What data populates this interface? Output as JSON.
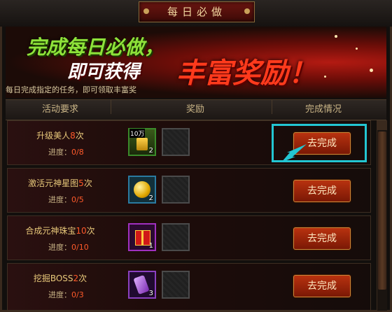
{
  "window": {
    "title": "每日必做"
  },
  "banner": {
    "line1": "完成每日必做，",
    "line2": "即可获得",
    "line3": "丰富奖励！",
    "subtitle": "每日完成指定的任务，即可领取丰富奖"
  },
  "table": {
    "headers": [
      "活动要求",
      "奖励",
      "完成情况"
    ],
    "progress_label": "进度：",
    "rows": [
      {
        "task_prefix": "升级美人",
        "task_count": "8",
        "task_suffix": "次",
        "progress": "0/8",
        "reward_icon": "gold-coins-10wan-icon",
        "reward_badge": "10万",
        "reward_count": "2",
        "button": "去完成"
      },
      {
        "task_prefix": "激活元神星图",
        "task_count": "5",
        "task_suffix": "次",
        "progress": "0/5",
        "reward_icon": "gold-orb-icon",
        "reward_count": "2",
        "button": "去完成"
      },
      {
        "task_prefix": "合成元神珠宝",
        "task_count": "10",
        "task_suffix": "次",
        "progress": "0/10",
        "reward_icon": "red-gift-box-icon",
        "reward_count": "1",
        "button": "去完成"
      },
      {
        "task_prefix": "挖掘BOSS",
        "task_count": "2",
        "task_suffix": "次",
        "progress": "0/3",
        "reward_icon": "purple-scroll-icon",
        "reward_count": "3",
        "button": "去完成"
      }
    ]
  },
  "colors": {
    "accent": "#ff5a2a",
    "highlight": "#23c6d2",
    "button": "#b8320f"
  }
}
